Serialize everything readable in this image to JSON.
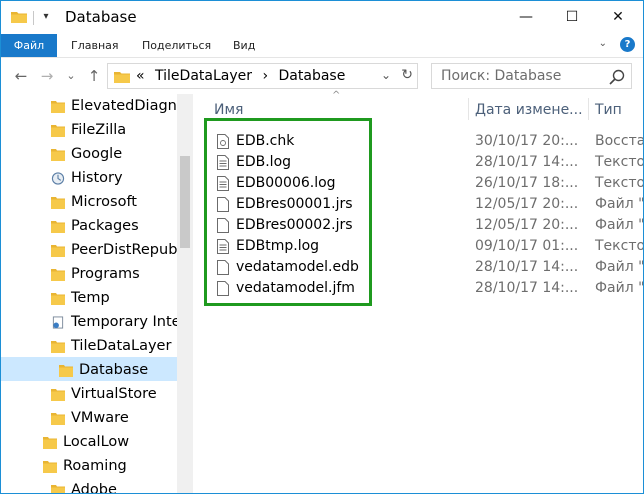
{
  "window": {
    "title": "Database",
    "qa_icon": "caret-down-icon",
    "minimize": "—",
    "maximize": "☐",
    "close": "✕"
  },
  "ribbon": {
    "tabs": [
      "Файл",
      "Главная",
      "Поделиться",
      "Вид"
    ],
    "expand": "⌄",
    "help": "?"
  },
  "nav": {
    "back": "←",
    "forward": "→",
    "recent": "⌄",
    "up": "↑"
  },
  "address": {
    "overflow": "«",
    "segments": [
      "TileDataLayer",
      "Database"
    ],
    "separator": "›",
    "dropdown": "⌄",
    "refresh": "↻"
  },
  "search": {
    "placeholder": "Поиск: Database"
  },
  "tree": {
    "items": [
      {
        "label": "ElevatedDiagnc",
        "icon": "folder"
      },
      {
        "label": "FileZilla",
        "icon": "folder"
      },
      {
        "label": "Google",
        "icon": "folder"
      },
      {
        "label": "History",
        "icon": "history"
      },
      {
        "label": "Microsoft",
        "icon": "folder"
      },
      {
        "label": "Packages",
        "icon": "folder"
      },
      {
        "label": "PeerDistRepub",
        "icon": "folder"
      },
      {
        "label": "Programs",
        "icon": "folder"
      },
      {
        "label": "Temp",
        "icon": "folder"
      },
      {
        "label": "Temporary Inte",
        "icon": "internet"
      },
      {
        "label": "TileDataLayer",
        "icon": "folder"
      },
      {
        "label": "Database",
        "icon": "folder",
        "selected": true
      },
      {
        "label": "VirtualStore",
        "icon": "folder"
      },
      {
        "label": "VMware",
        "icon": "folder"
      },
      {
        "label": "LocalLow",
        "icon": "folder"
      },
      {
        "label": "Roaming",
        "icon": "folder"
      },
      {
        "label": "Adobe",
        "icon": "folder"
      }
    ]
  },
  "columns": {
    "name": "Имя",
    "date": "Дата измене...",
    "type": "Тип",
    "sort_caret": "^"
  },
  "files": [
    {
      "name": "EDB.chk",
      "date": "30/10/17 20:...",
      "type": "Восста"
    },
    {
      "name": "EDB.log",
      "date": "28/10/17 14:...",
      "type": "Тексто"
    },
    {
      "name": "EDB00006.log",
      "date": "26/10/17 18:...",
      "type": "Тексто"
    },
    {
      "name": "EDBres00001.jrs",
      "date": "12/05/17 20:...",
      "type": "Файл \""
    },
    {
      "name": "EDBres00002.jrs",
      "date": "12/05/17 20:...",
      "type": "Файл \""
    },
    {
      "name": "EDBtmp.log",
      "date": "09/10/17 01:...",
      "type": "Тексто"
    },
    {
      "name": "vedatamodel.edb",
      "date": "28/10/17 14:...",
      "type": "Файл \""
    },
    {
      "name": "vedatamodel.jfm",
      "date": "28/10/17 14:...",
      "type": "Файл \""
    }
  ],
  "colors": {
    "accent": "#1979ca",
    "selection": "#cce8ff",
    "highlight_box": "#1f9a1f",
    "folder": "#f6c94a"
  }
}
